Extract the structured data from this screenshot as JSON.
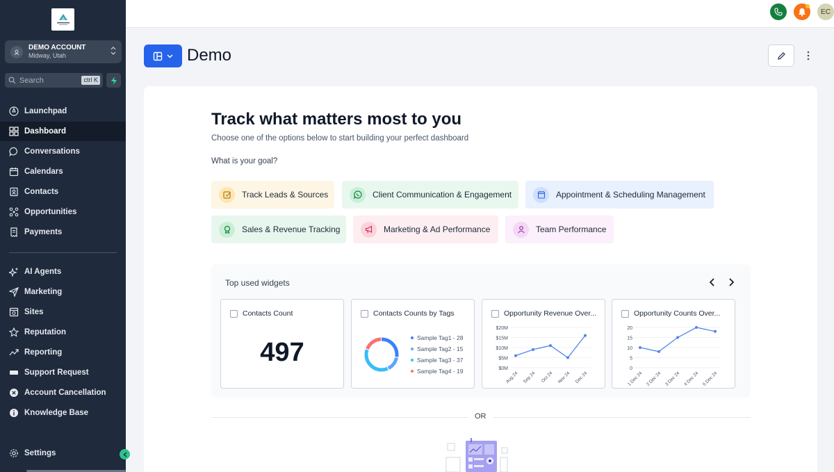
{
  "sidebar": {
    "logo_icon": "company-logo",
    "account": {
      "name": "DEMO ACCOUNT",
      "location": "Midway, Utah"
    },
    "search": {
      "label": "Search",
      "shortcut": "ctrl K"
    },
    "items": [
      {
        "label": "Launchpad",
        "icon": "rocket-icon"
      },
      {
        "label": "Dashboard",
        "icon": "grid-icon",
        "active": true
      },
      {
        "label": "Conversations",
        "icon": "chat-icon"
      },
      {
        "label": "Calendars",
        "icon": "calendar-icon"
      },
      {
        "label": "Contacts",
        "icon": "contacts-icon"
      },
      {
        "label": "Opportunities",
        "icon": "network-icon"
      },
      {
        "label": "Payments",
        "icon": "receipt-icon"
      }
    ],
    "items2": [
      {
        "label": "AI Agents",
        "icon": "sparkle-icon"
      },
      {
        "label": "Marketing",
        "icon": "send-icon"
      },
      {
        "label": "Sites",
        "icon": "site-icon"
      },
      {
        "label": "Reputation",
        "icon": "star-icon"
      },
      {
        "label": "Reporting",
        "icon": "trend-icon"
      },
      {
        "label": "Support Request",
        "icon": "ticket-icon"
      },
      {
        "label": "Account Cancellation",
        "icon": "cancel-icon"
      },
      {
        "label": "Knowledge Base",
        "icon": "info-icon"
      }
    ],
    "settings": {
      "label": "Settings"
    }
  },
  "topbar": {
    "avatar_initials": "EC",
    "colors": {
      "phone": "#15803d",
      "bell": "#f97316",
      "avatar": "#d6d3b4"
    }
  },
  "page": {
    "title": "Demo"
  },
  "main": {
    "heading": "Track what matters most to you",
    "subheading": "Choose one of the options below to start building your perfect dashboard",
    "goal_question": "What is your goal?",
    "goals": [
      {
        "label": "Track Leads & Sources",
        "bg": "#fef6e4",
        "icon_bg": "#fde7b0",
        "icon": "lead-icon"
      },
      {
        "label": "Client Communication & Engagement",
        "bg": "#e9f8ef",
        "icon_bg": "#c9efd8",
        "icon": "whatsapp-icon"
      },
      {
        "label": "Appointment & Scheduling Management",
        "bg": "#e8f1fd",
        "icon_bg": "#cfe0fa",
        "icon": "calendar-icon"
      },
      {
        "label": "Sales & Revenue Tracking",
        "bg": "#e8f7ee",
        "icon_bg": "#c8eed6",
        "icon": "award-icon"
      },
      {
        "label": "Marketing & Ad Performance",
        "bg": "#fdeef1",
        "icon_bg": "#fad3dc",
        "icon": "megaphone-icon"
      },
      {
        "label": "Team Performance",
        "bg": "#fbf0fb",
        "icon_bg": "#f2d9f4",
        "icon": "user-icon"
      }
    ],
    "widgets": {
      "title": "Top used widgets",
      "cards": [
        {
          "label": "Contacts Count",
          "value": "497"
        },
        {
          "label": "Contacts Counts by Tags",
          "legend": [
            {
              "text": "Sample Tag1 - 28",
              "color": "#3b82f6"
            },
            {
              "text": "Sample Tag2 - 15",
              "color": "#60a5fa"
            },
            {
              "text": "Sample Tag3 - 37",
              "color": "#38bdf8"
            },
            {
              "text": "Sample Tag4 - 19",
              "color": "#f87171"
            }
          ]
        },
        {
          "label": "Opportunity Revenue Over..."
        },
        {
          "label": "Opportunity Counts Over..."
        }
      ]
    },
    "or_text": "OR"
  },
  "chart_data": [
    {
      "type": "pie",
      "categories": [
        "Sample Tag1",
        "Sample Tag2",
        "Sample Tag3",
        "Sample Tag4"
      ],
      "values": [
        28,
        15,
        37,
        19
      ]
    },
    {
      "type": "line",
      "categories": [
        "Aug 24",
        "Sep 24",
        "Oct 24",
        "Nov 24",
        "Dec 24"
      ],
      "y_ticks": [
        "$0M",
        "$5M",
        "$10M",
        "$15M",
        "$20M"
      ],
      "ylim": [
        0,
        20
      ],
      "values": [
        6,
        9,
        11,
        5,
        16
      ]
    },
    {
      "type": "line",
      "categories": [
        "1 Dec 24",
        "2 Dec 24",
        "3 Dec 24",
        "4 Dec 24",
        "5 Dec 24"
      ],
      "y_ticks": [
        "0",
        "5",
        "10",
        "15",
        "20"
      ],
      "ylim": [
        0,
        20
      ],
      "values": [
        10,
        8,
        15,
        20,
        18
      ]
    }
  ]
}
